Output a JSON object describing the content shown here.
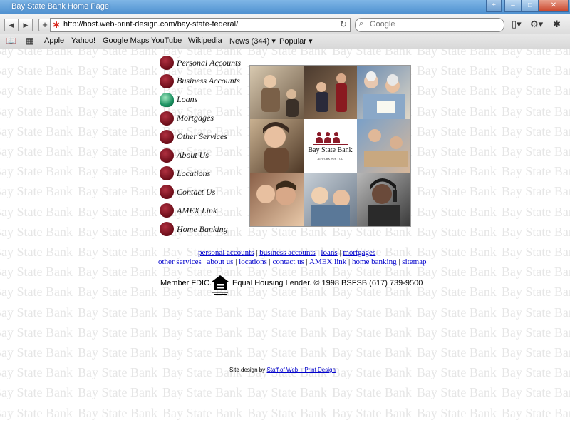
{
  "window": {
    "title": "Bay State Bank Home Page"
  },
  "toolbar": {
    "back_icon": "back-arrow-icon",
    "forward_icon": "forward-arrow-icon",
    "url": "http://host.web-print-design.com/bay-state-federal/",
    "search_placeholder": "Google"
  },
  "bookmarks": [
    {
      "label": "Apple"
    },
    {
      "label": "Yahoo!"
    },
    {
      "label": "Google Maps"
    },
    {
      "label": "YouTube"
    },
    {
      "label": "Wikipedia"
    },
    {
      "label": "News (344)"
    },
    {
      "label": "Popular"
    }
  ],
  "watermark_text": "Bay State Bank",
  "nav": {
    "items": [
      {
        "label": "Personal Accounts"
      },
      {
        "label": "Business Accounts"
      },
      {
        "label": "Loans"
      },
      {
        "label": "Mortgages"
      },
      {
        "label": "Other Services"
      },
      {
        "label": "About Us"
      },
      {
        "label": "Locations"
      },
      {
        "label": "Contact Us"
      },
      {
        "label": "AMEX Link"
      },
      {
        "label": "Home Banking"
      }
    ],
    "active_item": "Loans"
  },
  "logo": {
    "name": "Bay State Bank",
    "tagline": "AT WORK FOR YOU"
  },
  "text_links": {
    "row1": [
      "personal accounts",
      "business accounts",
      "loans",
      "mortgages"
    ],
    "row2": [
      "other services",
      "about us",
      "locations",
      "contact us",
      "AMEX link",
      "home banking",
      "sitemap"
    ]
  },
  "footer": {
    "member": "Member FDIC.",
    "lender": "Equal Housing Lender. © 1998 BSFSB (617) 739-9500",
    "credit_prefix": "Site design by",
    "credit_link": "Staff of Web + Print Design"
  },
  "colors": {
    "nav_ball": "#7a0f1e",
    "link": "#0000cc",
    "watermark": "#e6e6e6"
  }
}
